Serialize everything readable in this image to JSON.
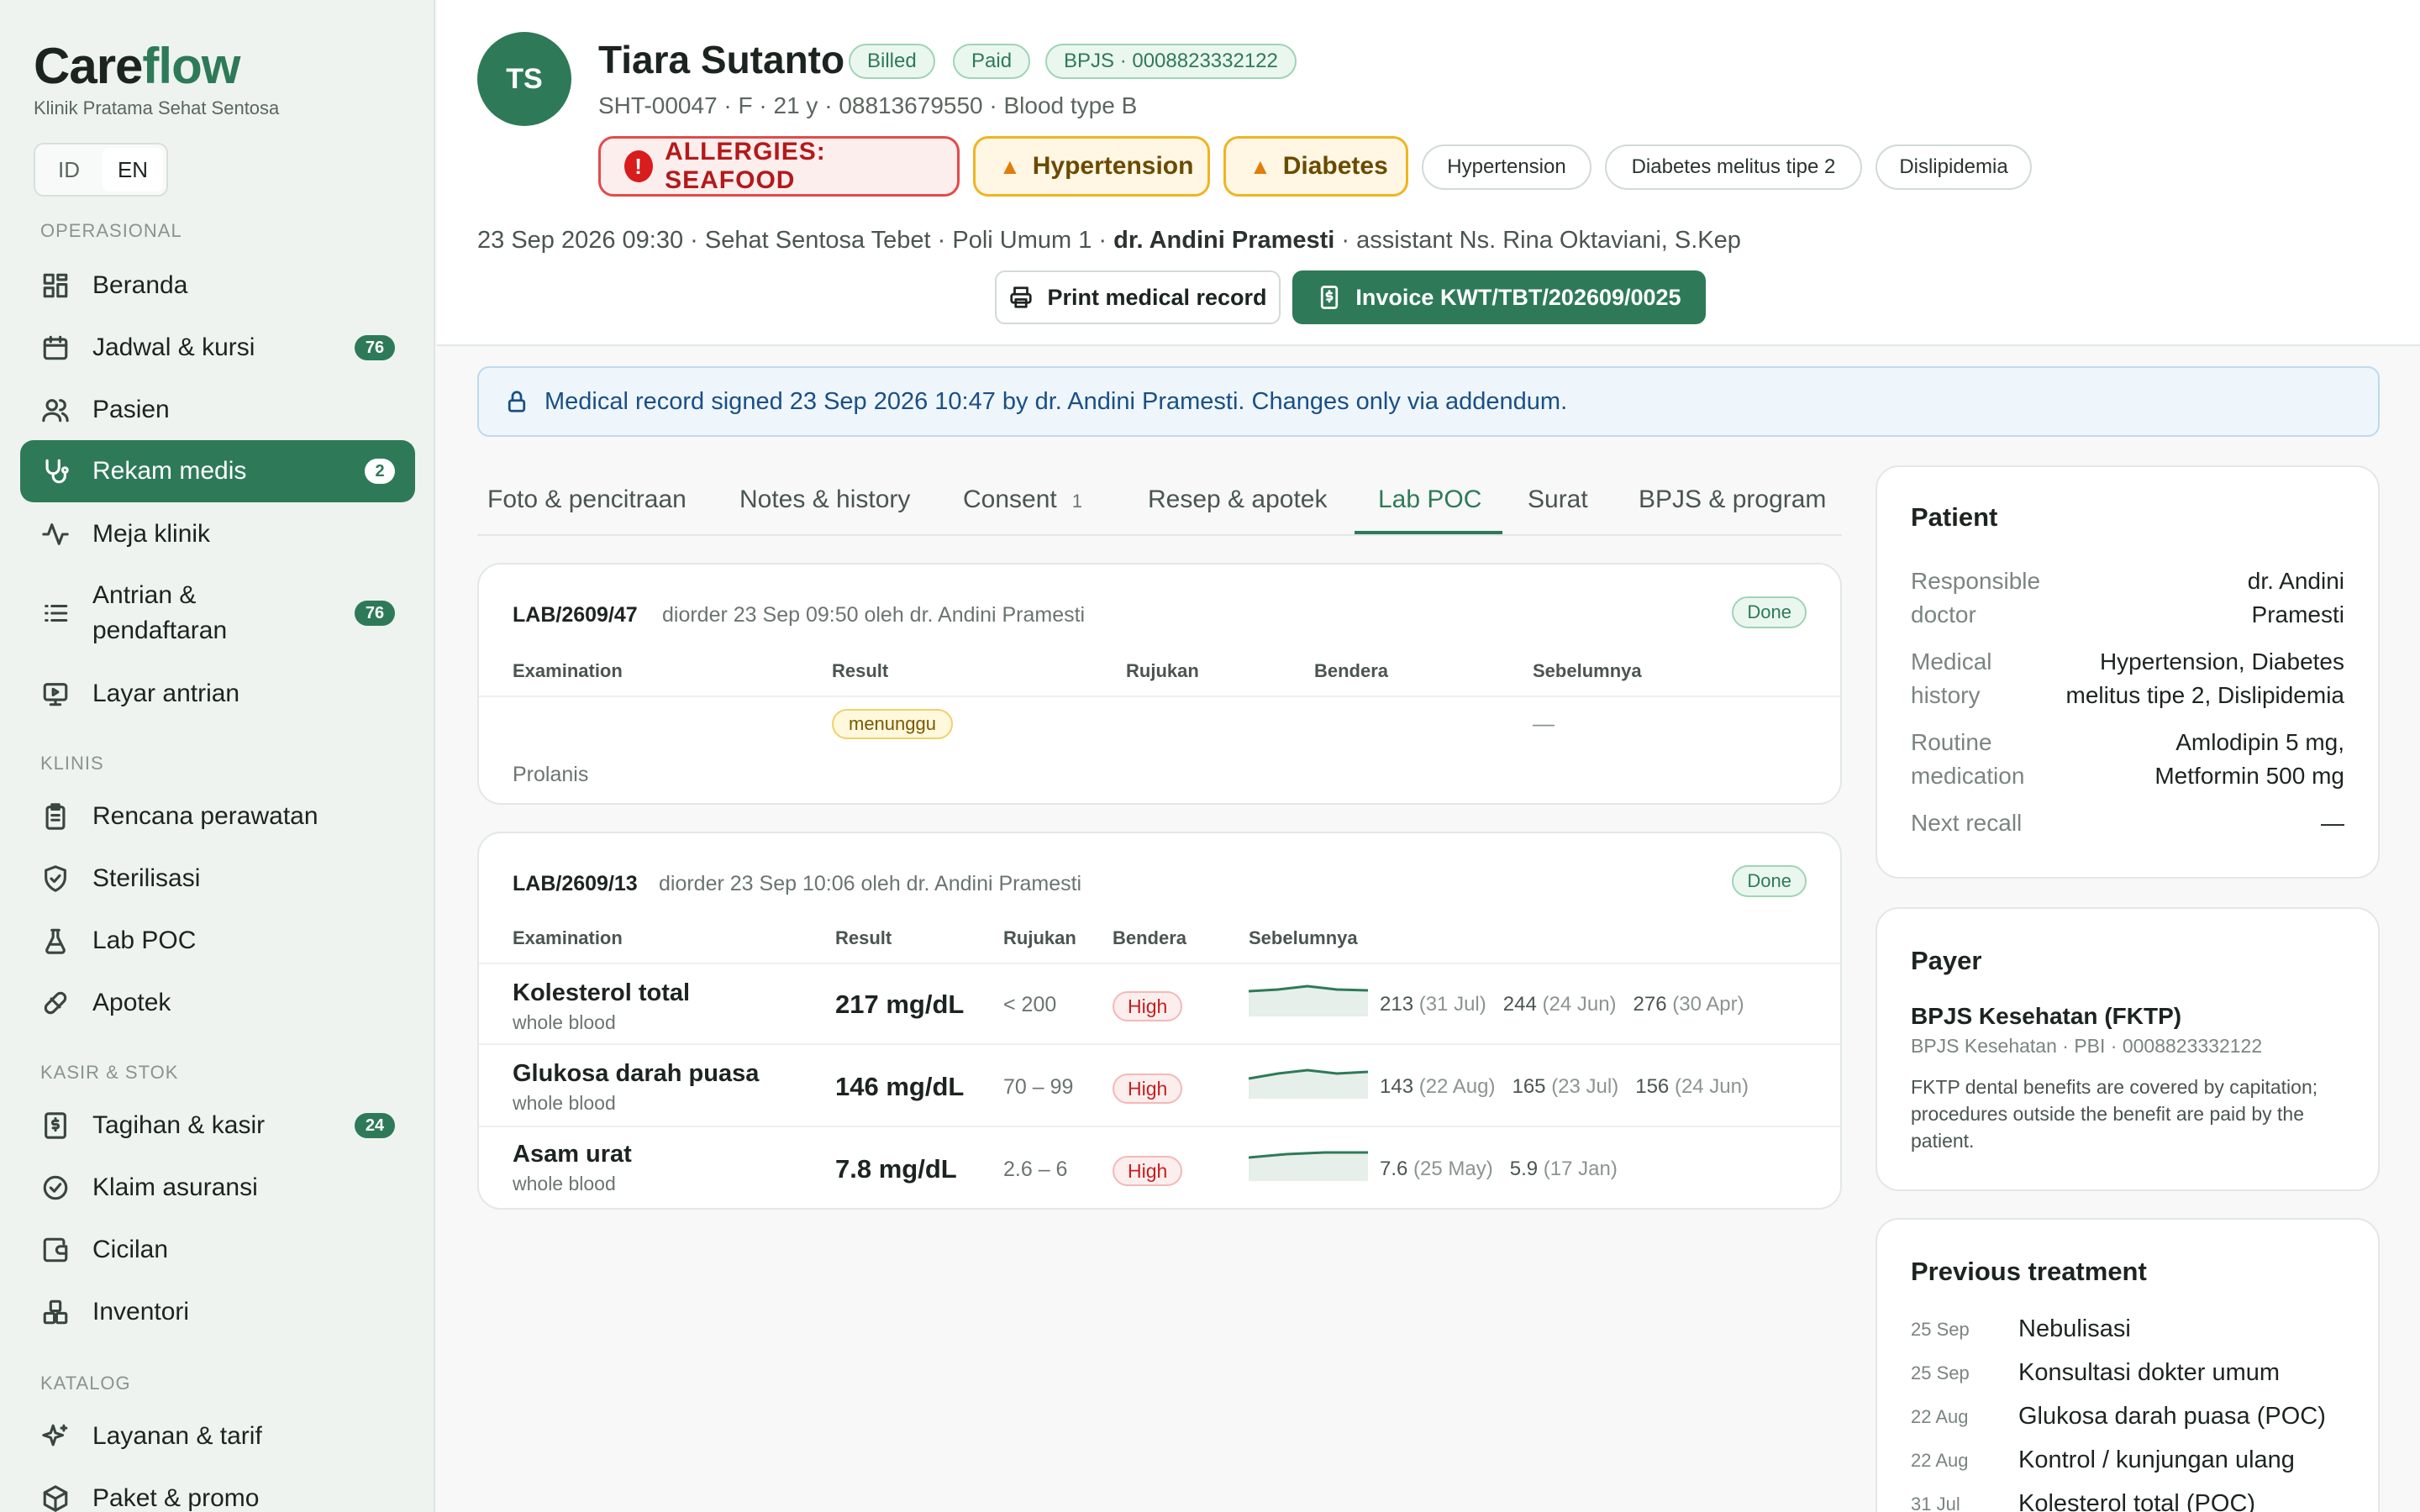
{
  "brand": {
    "care": "Care",
    "flow": "flow",
    "clinic": "Klinik Pratama Sehat Sentosa"
  },
  "lang": {
    "id": "ID",
    "en": "EN",
    "active": "EN"
  },
  "sidebar": {
    "sections": [
      "OPERASIONAL",
      "KLINIS",
      "KASIR & STOK",
      "KATALOG"
    ],
    "items": [
      {
        "label": "Beranda",
        "icon": "dashboard-icon"
      },
      {
        "label": "Jadwal & kursi",
        "icon": "calendar-icon",
        "badge": "76"
      },
      {
        "label": "Pasien",
        "icon": "users-icon"
      },
      {
        "label": "Rekam medis",
        "icon": "stethoscope-icon",
        "badge": "2",
        "active": true
      },
      {
        "label": "Meja klinik",
        "icon": "activity-icon"
      },
      {
        "label": "Antrian & pendaftaran",
        "line1": "Antrian &",
        "line2": "pendaftaran",
        "icon": "list-icon",
        "badge": "76"
      },
      {
        "label": "Layar antrian",
        "icon": "monitor-icon"
      },
      {
        "label": "Rencana perawatan",
        "icon": "clipboard-icon"
      },
      {
        "label": "Sterilisasi",
        "icon": "shield-check-icon"
      },
      {
        "label": "Lab POC",
        "icon": "flask-icon"
      },
      {
        "label": "Apotek",
        "icon": "pill-icon"
      },
      {
        "label": "Tagihan & kasir",
        "icon": "receipt-icon",
        "badge": "24"
      },
      {
        "label": "Klaim asuransi",
        "icon": "check-circle-icon"
      },
      {
        "label": "Cicilan",
        "icon": "wallet-icon"
      },
      {
        "label": "Inventori",
        "icon": "boxes-icon"
      },
      {
        "label": "Layanan & tarif",
        "icon": "sparkles-icon"
      },
      {
        "label": "Paket & promo",
        "icon": "package-icon"
      }
    ]
  },
  "patient": {
    "initials": "TS",
    "name": "Tiara Sutanto",
    "badges": [
      "Billed",
      "Paid",
      "BPJS · 0008823332122"
    ],
    "subtitle": "SHT-00047 · F · 21 y · 08813679550 · Blood type B",
    "alerts": {
      "allergy": "ALLERGIES: SEAFOOD",
      "warn1": "Hypertension",
      "warn2": "Diabetes"
    },
    "conditions": [
      "Hypertension",
      "Diabetes melitus tipe 2",
      "Dislipidemia"
    ]
  },
  "visit": {
    "pre": "23 Sep 2026 09:30 · Sehat Sentosa Tebet · Poli Umum 1 · ",
    "doctor": "dr. Andini Pramesti",
    "post": " · assistant Ns. Rina Oktaviani, S.Kep"
  },
  "actions": {
    "print": "Print medical record",
    "invoice": "Invoice KWT/TBT/202609/0025"
  },
  "banner": "Medical record signed 23 Sep 2026 10:47 by dr. Andini Pramesti. Changes only via addendum.",
  "tabs": [
    {
      "label": "Foto & pencitraan"
    },
    {
      "label": "Notes & history"
    },
    {
      "label": "Consent",
      "count": "1"
    },
    {
      "label": "Resep & apotek"
    },
    {
      "label": "Lab POC",
      "active": true
    },
    {
      "label": "Surat"
    },
    {
      "label": "BPJS & program"
    }
  ],
  "columns": {
    "exam": "Examination",
    "result": "Result",
    "ref": "Rujukan",
    "flag": "Bendera",
    "prev": "Sebelumnya"
  },
  "labs": [
    {
      "id": "LAB/2609/47",
      "ordered": "diorder 23 Sep 09:50 oleh dr. Andini Pramesti",
      "status": "Done",
      "pending": "menunggu",
      "prev_empty": "—",
      "note": "Prolanis"
    },
    {
      "id": "LAB/2609/13",
      "ordered": "diorder 23 Sep 10:06 oleh dr. Andini Pramesti",
      "status": "Done",
      "rows": [
        {
          "name": "Kolesterol total",
          "specimen": "whole blood",
          "result": "217 mg/dL",
          "ref": "< 200",
          "flag": "High",
          "prev": [
            {
              "v": "213",
              "d": "(31 Jul)"
            },
            {
              "v": "244",
              "d": "(24 Jun)"
            },
            {
              "v": "276",
              "d": "(30 Apr)"
            }
          ]
        },
        {
          "name": "Glukosa darah puasa",
          "specimen": "whole blood",
          "result": "146 mg/dL",
          "ref": "70 – 99",
          "flag": "High",
          "prev": [
            {
              "v": "143",
              "d": "(22 Aug)"
            },
            {
              "v": "165",
              "d": "(23 Jul)"
            },
            {
              "v": "156",
              "d": "(24 Jun)"
            }
          ]
        },
        {
          "name": "Asam urat",
          "specimen": "whole blood",
          "result": "7.8 mg/dL",
          "ref": "2.6 – 6",
          "flag": "High",
          "prev": [
            {
              "v": "7.6",
              "d": "(25 May)"
            },
            {
              "v": "5.9",
              "d": "(17 Jan)"
            }
          ]
        }
      ]
    }
  ],
  "panel_patient": {
    "title": "Patient",
    "doctor_label_1": "Responsible",
    "doctor_label_2": "doctor",
    "doctor_value_1": "dr. Andini",
    "doctor_value_2": "Pramesti",
    "history_label_1": "Medical",
    "history_label_2": "history",
    "history_value_1": "Hypertension, Diabetes",
    "history_value_2": "melitus tipe 2, Dislipidemia",
    "med_label_1": "Routine",
    "med_label_2": "medication",
    "med_value_1": "Amlodipin 5 mg,",
    "med_value_2": "Metformin 500 mg",
    "recall_label": "Next recall",
    "recall_value": "—"
  },
  "panel_payer": {
    "title": "Payer",
    "name": "BPJS Kesehatan (FKTP)",
    "sub": "BPJS Kesehatan · PBI · 0008823332122",
    "desc": "FKTP dental benefits are covered by capitation; procedures outside the benefit are paid by the patient."
  },
  "panel_history": {
    "title": "Previous treatment",
    "items": [
      {
        "date": "25 Sep",
        "name": "Nebulisasi"
      },
      {
        "date": "25 Sep",
        "name": "Konsultasi dokter umum"
      },
      {
        "date": "22 Aug",
        "name": "Glukosa darah puasa (POC)"
      },
      {
        "date": "22 Aug",
        "name": "Kontrol / kunjungan ulang"
      },
      {
        "date": "31 Jul",
        "name": "Kolesterol total (POC)"
      }
    ]
  }
}
